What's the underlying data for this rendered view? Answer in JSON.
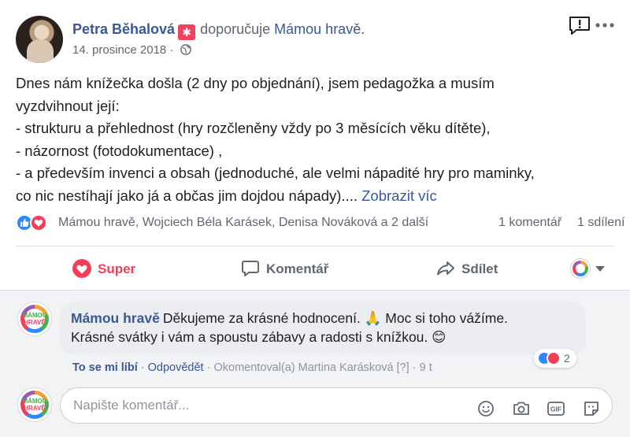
{
  "post": {
    "author": "Petra Běhalová",
    "recommend_text": "doporučuje",
    "page_name": "Mámou hravě.",
    "date": "14. prosince 2018",
    "separator": "·",
    "body_lines": [
      "Dnes nám knížečka došla (2 dny po objednání), jsem pedagožka a musím",
      "vyzdvihnout její:",
      "- strukturu a přehlednost (hry rozčleněny vždy po 3 měsících věku dítěte),",
      "- názornost (fotodokumentace) ,",
      "- a především invenci a obsah (jednoduché, ale velmi nápadité hry pro maminky,",
      "co nic nestíhají jako já a občas jim dojdou nápady)....  "
    ],
    "see_more": "Zobrazit víc"
  },
  "reactions": {
    "names": "Mámou hravě, Wojciech Béla Karásek, Denisa Nováková a 2 další",
    "comment_count": "1 komentář",
    "share_count": "1 sdílení"
  },
  "actions": {
    "super": "Super",
    "comment": "Komentář",
    "share": "Sdílet"
  },
  "comment": {
    "author": "Mámou hravě",
    "line1": "Děkujeme za krásné hodnocení. 🙏 Moc si toho vážíme.",
    "line2": "Krásné svátky i vám a spoustu zábavy a radosti s knížkou. 😊",
    "reaction_count": "2",
    "like_label": "To se mi líbí",
    "reply_label": "Odpovědět",
    "meta": "Okomentoval(a) Martina Karásková [?]",
    "time": "9 t",
    "dot": "·"
  },
  "composer": {
    "placeholder": "Napište komentář..."
  },
  "logo": {
    "word1": "MÁMOU",
    "word2": "HRAVĚ"
  },
  "icons": {
    "report": "report-icon",
    "more": "more-options-icon",
    "globe": "globe-icon",
    "emoji": "emoji-icon",
    "camera": "camera-icon",
    "gif": "gif-icon",
    "sticker": "sticker-icon"
  },
  "colors": {
    "link": "#385898",
    "love": "#f33e58",
    "like": "#2d88ff",
    "recommend": "#f3425f"
  }
}
